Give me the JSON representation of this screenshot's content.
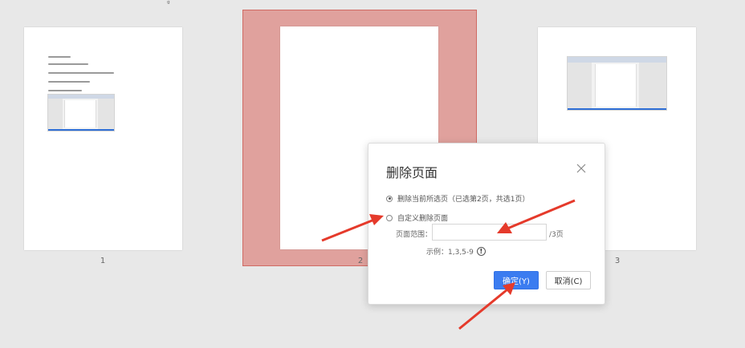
{
  "pages": [
    {
      "number": "1"
    },
    {
      "number": "2",
      "selected": true
    },
    {
      "number": "3"
    }
  ],
  "selection_color": "#e0a19d",
  "dialog": {
    "title": "删除页面",
    "close_icon": "close-icon",
    "option_current": "删除当前所选页（已选第2页，共选1页）",
    "option_custom": "自定义删除页面",
    "range_label": "页面范围：",
    "range_value": "",
    "range_total": "/3页",
    "example_text": "示例：1,3,5-9",
    "info_icon": "info-icon",
    "ok_label": "确定(Y)",
    "cancel_label": "取消(C)",
    "ok_color": "#3b7cf0"
  },
  "annotation_arrow_color": "#e53a2b"
}
